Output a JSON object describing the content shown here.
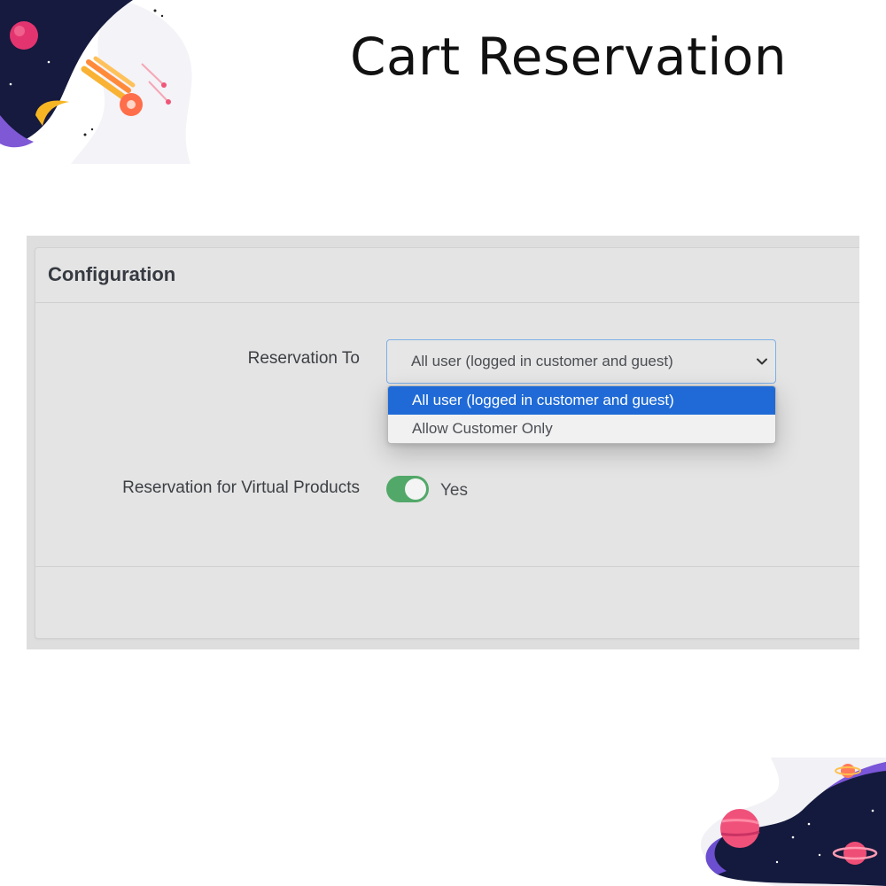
{
  "header": {
    "title": "Cart Reservation"
  },
  "panel": {
    "title": "Configuration"
  },
  "fields": {
    "reservation_to": {
      "label": "Reservation To",
      "selected_value": "All user (logged in customer and guest)",
      "options": [
        "All user (logged in customer and guest)",
        "Allow Customer Only"
      ],
      "dropdown_open": true
    },
    "virtual_products": {
      "label": "Reservation for Virtual Products",
      "toggle_on": true,
      "toggle_text": "Yes"
    }
  },
  "colors": {
    "accent_selected": "#1f6ad6",
    "toggle_on": "#52a868",
    "select_focus_border": "#7cb0e8"
  },
  "icons": {
    "select_arrow": "chevron-down-icon",
    "decoration_top": "comet-space-illustration",
    "decoration_bottom": "planet-space-illustration"
  }
}
